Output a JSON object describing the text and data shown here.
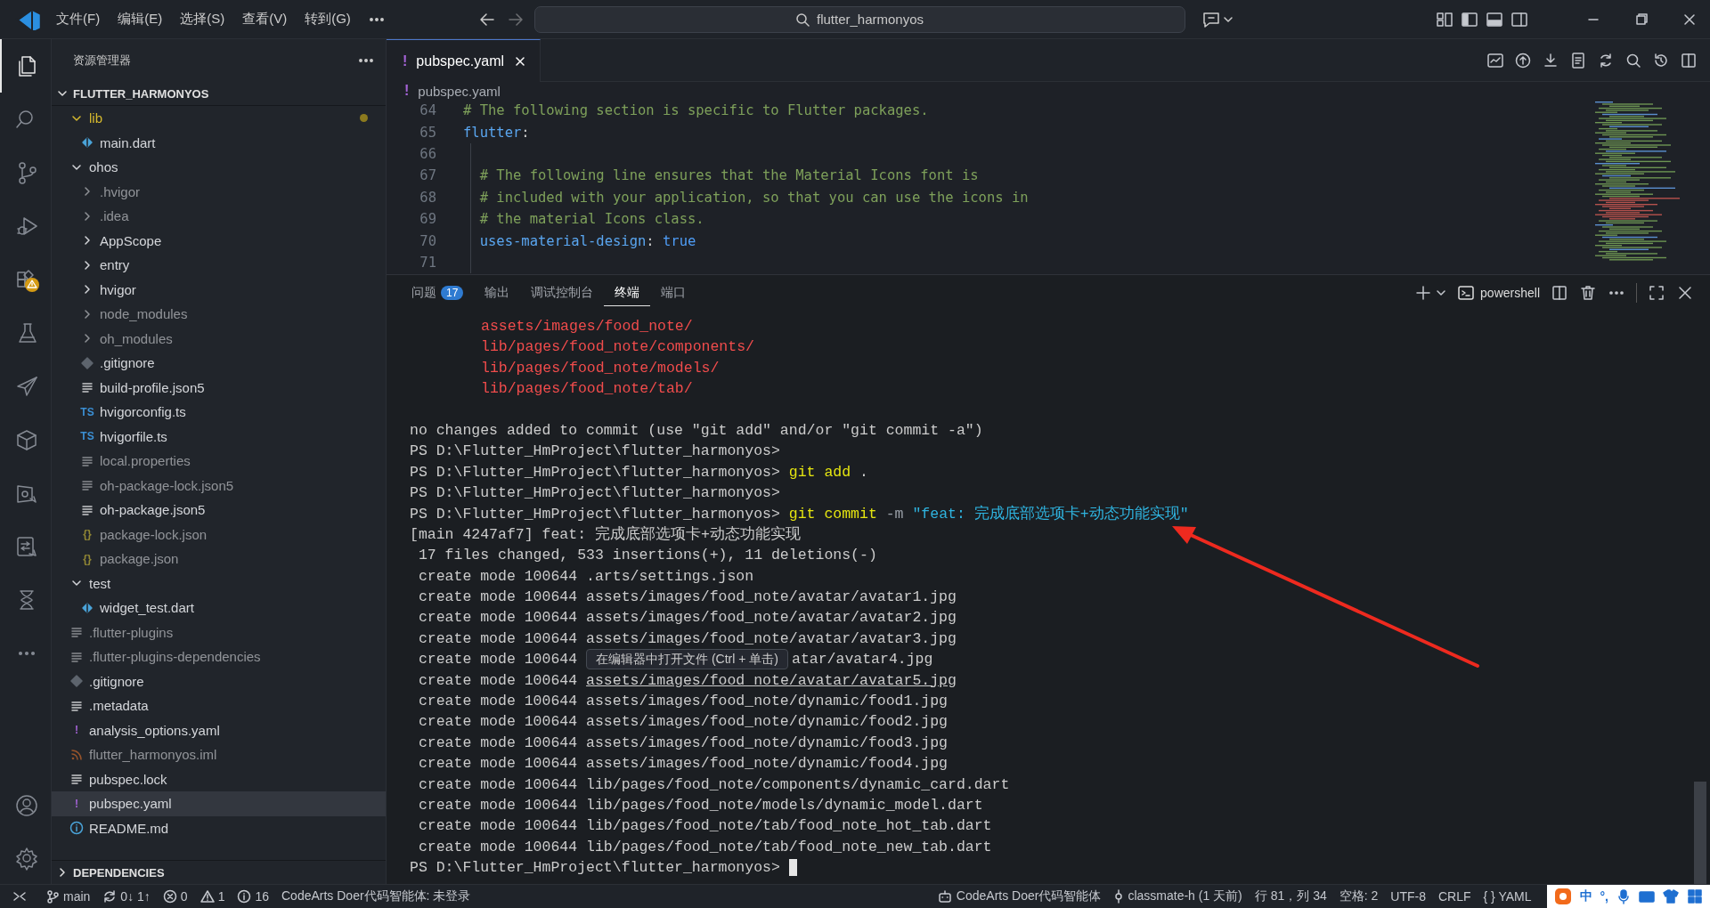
{
  "title_bar": {
    "menus": [
      "文件(F)",
      "编辑(E)",
      "选择(S)",
      "查看(V)",
      "转到(G)"
    ],
    "command_center": "flutter_harmonyos"
  },
  "activity_bar": {
    "top": [
      {
        "kind": "files",
        "selected": true
      },
      {
        "kind": "search",
        "selected": false
      },
      {
        "kind": "source-control",
        "selected": false
      },
      {
        "kind": "run-debug",
        "selected": false
      },
      {
        "kind": "extensions",
        "selected": false
      },
      {
        "kind": "flask",
        "selected": false
      },
      {
        "kind": "paper-plane",
        "selected": false
      },
      {
        "kind": "cube",
        "selected": false
      },
      {
        "kind": "device-bug",
        "selected": false
      },
      {
        "kind": "checklist",
        "selected": false
      },
      {
        "kind": "hourglass",
        "selected": false
      },
      {
        "kind": "more",
        "selected": false
      }
    ],
    "bottom": [
      {
        "kind": "account",
        "selected": false
      },
      {
        "kind": "settings",
        "selected": false
      }
    ]
  },
  "explorer": {
    "title": "资源管理器",
    "root": "FLUTTER_HARMONYOS",
    "tree": [
      {
        "name": "lib",
        "kind": "folder",
        "expanded": true,
        "modified": true,
        "dimmed": false,
        "selected": false,
        "children": [
          {
            "name": "main.dart",
            "kind": "dart",
            "modified": false,
            "dimmed": false,
            "selected": false
          }
        ]
      },
      {
        "name": "ohos",
        "kind": "folder",
        "expanded": true,
        "modified": false,
        "dimmed": false,
        "selected": false,
        "children": [
          {
            "name": ".hvigor",
            "kind": "folder",
            "expanded": false,
            "modified": false,
            "dimmed": true,
            "selected": false
          },
          {
            "name": ".idea",
            "kind": "folder",
            "expanded": false,
            "modified": false,
            "dimmed": true,
            "selected": false
          },
          {
            "name": "AppScope",
            "kind": "folder",
            "expanded": false,
            "modified": false,
            "dimmed": false,
            "selected": false
          },
          {
            "name": "entry",
            "kind": "folder",
            "expanded": false,
            "modified": false,
            "dimmed": false,
            "selected": false
          },
          {
            "name": "hvigor",
            "kind": "folder",
            "expanded": false,
            "modified": false,
            "dimmed": false,
            "selected": false
          },
          {
            "name": "node_modules",
            "kind": "folder",
            "expanded": false,
            "modified": false,
            "dimmed": true,
            "selected": false
          },
          {
            "name": "oh_modules",
            "kind": "folder",
            "expanded": false,
            "modified": false,
            "dimmed": true,
            "selected": false
          },
          {
            "name": ".gitignore",
            "kind": "git",
            "modified": false,
            "dimmed": false,
            "selected": false
          },
          {
            "name": "build-profile.json5",
            "kind": "lines",
            "modified": false,
            "dimmed": false,
            "selected": false
          },
          {
            "name": "hvigorconfig.ts",
            "kind": "ts",
            "icon_label": "TS",
            "modified": false,
            "dimmed": false,
            "selected": false
          },
          {
            "name": "hvigorfile.ts",
            "kind": "ts",
            "icon_label": "TS",
            "modified": false,
            "dimmed": false,
            "selected": false
          },
          {
            "name": "local.properties",
            "kind": "lines",
            "modified": false,
            "dimmed": true,
            "selected": false
          },
          {
            "name": "oh-package-lock.json5",
            "kind": "lines",
            "modified": false,
            "dimmed": true,
            "selected": false
          },
          {
            "name": "oh-package.json5",
            "kind": "lines",
            "modified": false,
            "dimmed": false,
            "selected": false
          },
          {
            "name": "package-lock.json",
            "kind": "json",
            "icon_label": "{}",
            "modified": false,
            "dimmed": true,
            "selected": false
          },
          {
            "name": "package.json",
            "kind": "json",
            "icon_label": "{}",
            "modified": false,
            "dimmed": true,
            "selected": false
          }
        ]
      },
      {
        "name": "test",
        "kind": "folder",
        "expanded": true,
        "modified": false,
        "dimmed": false,
        "selected": false,
        "children": [
          {
            "name": "widget_test.dart",
            "kind": "dart",
            "modified": false,
            "dimmed": false,
            "selected": false
          }
        ]
      },
      {
        "name": ".flutter-plugins",
        "kind": "lines",
        "modified": false,
        "dimmed": true,
        "selected": false
      },
      {
        "name": ".flutter-plugins-dependencies",
        "kind": "lines",
        "modified": false,
        "dimmed": true,
        "selected": false
      },
      {
        "name": ".gitignore",
        "kind": "git",
        "modified": false,
        "dimmed": false,
        "selected": false
      },
      {
        "name": ".metadata",
        "kind": "lines",
        "modified": false,
        "dimmed": false,
        "selected": false
      },
      {
        "name": "analysis_options.yaml",
        "kind": "yaml",
        "icon_label": "!",
        "modified": false,
        "dimmed": false,
        "selected": false
      },
      {
        "name": "flutter_harmonyos.iml",
        "kind": "rss",
        "modified": false,
        "dimmed": true,
        "selected": false
      },
      {
        "name": "pubspec.lock",
        "kind": "lines",
        "modified": false,
        "dimmed": false,
        "selected": false
      },
      {
        "name": "pubspec.yaml",
        "kind": "yaml",
        "icon_label": "!",
        "modified": false,
        "dimmed": false,
        "selected": true
      },
      {
        "name": "README.md",
        "kind": "info",
        "modified": false,
        "dimmed": false,
        "selected": false
      }
    ],
    "dependencies": "DEPENDENCIES"
  },
  "editor": {
    "tabs": [
      {
        "label": "pubspec.yaml",
        "icon_label": "!",
        "selected": true
      }
    ],
    "breadcrumb": {
      "icon_label": "!",
      "text": "pubspec.yaml"
    },
    "lines": [
      {
        "number": "64",
        "guide": false,
        "segments": [
          {
            "kind": "comment",
            "text": "# The following section is specific to Flutter packages."
          }
        ]
      },
      {
        "number": "65",
        "guide": false,
        "segments": [
          {
            "kind": "key",
            "text": "flutter"
          },
          {
            "kind": "plain",
            "text": ":"
          }
        ]
      },
      {
        "number": "66",
        "guide": true
      },
      {
        "number": "67",
        "guide": true,
        "segments": [
          {
            "kind": "comment",
            "text": "  # The following line ensures that the Material Icons font is"
          }
        ]
      },
      {
        "number": "68",
        "guide": true,
        "segments": [
          {
            "kind": "comment",
            "text": "  # included with your application, so that you can use the icons in"
          }
        ]
      },
      {
        "number": "69",
        "guide": true,
        "segments": [
          {
            "kind": "comment",
            "text": "  # the material Icons class."
          }
        ]
      },
      {
        "number": "70",
        "guide": true,
        "segments": [
          {
            "kind": "key",
            "text": "  uses-material-design"
          },
          {
            "kind": "plain",
            "text": ": "
          },
          {
            "kind": "bool",
            "text": "true"
          }
        ]
      },
      {
        "number": "71",
        "guide": true
      }
    ]
  },
  "panel": {
    "tabs": [
      {
        "label": "问题",
        "badge": "17",
        "selected": false
      },
      {
        "label": "输出",
        "selected": false
      },
      {
        "label": "调试控制台",
        "selected": false
      },
      {
        "label": "终端",
        "selected": true
      },
      {
        "label": "端口",
        "selected": false
      }
    ],
    "shell": "powershell",
    "terminal": [
      {
        "kind": "text",
        "segments": [
          {
            "kind": "untracked",
            "text": "assets/images/food_note/"
          }
        ]
      },
      {
        "kind": "text",
        "segments": [
          {
            "kind": "untracked",
            "text": "lib/pages/food_note/components/"
          }
        ]
      },
      {
        "kind": "text",
        "segments": [
          {
            "kind": "untracked",
            "text": "lib/pages/food_note/models/"
          }
        ]
      },
      {
        "kind": "text",
        "segments": [
          {
            "kind": "untracked",
            "text": "lib/pages/food_note/tab/"
          }
        ]
      },
      {
        "kind": "blank"
      },
      {
        "kind": "text",
        "segments": [
          {
            "kind": "output",
            "text": "no changes added to commit (use \"git add\" and/or \"git commit -a\")"
          }
        ]
      },
      {
        "kind": "text",
        "segments": [
          {
            "kind": "prompt",
            "text": "PS D:\\Flutter_HmProject\\flutter_harmonyos>"
          }
        ]
      },
      {
        "kind": "text",
        "segments": [
          {
            "kind": "prompt",
            "text": "PS D:\\Flutter_HmProject\\flutter_harmonyos> "
          },
          {
            "kind": "command",
            "text": "git add"
          },
          {
            "kind": "output",
            "text": " ."
          }
        ]
      },
      {
        "kind": "text",
        "segments": [
          {
            "kind": "prompt",
            "text": "PS D:\\Flutter_HmProject\\flutter_harmonyos>"
          }
        ]
      },
      {
        "kind": "text",
        "segments": [
          {
            "kind": "prompt",
            "text": "PS D:\\Flutter_HmProject\\flutter_harmonyos> "
          },
          {
            "kind": "command",
            "text": "git commit"
          },
          {
            "kind": "flag",
            "text": " -m "
          },
          {
            "kind": "string",
            "text": "\"feat: 完成底部选项卡+动态功能实现\""
          }
        ]
      },
      {
        "kind": "text",
        "segments": [
          {
            "kind": "output",
            "text": "[main 4247af7] feat: 完成底部选项卡+动态功能实现"
          }
        ]
      },
      {
        "kind": "text",
        "segments": [
          {
            "kind": "output",
            "text": " 17 files changed, 533 insertions(+), 11 deletions(-)"
          }
        ]
      },
      {
        "kind": "text",
        "segments": [
          {
            "kind": "output",
            "text": " create mode 100644 .arts/settings.json"
          }
        ]
      },
      {
        "kind": "text",
        "segments": [
          {
            "kind": "output",
            "text": " create mode 100644 assets/images/food_note/avatar/avatar1.jpg"
          }
        ]
      },
      {
        "kind": "text",
        "segments": [
          {
            "kind": "output",
            "text": " create mode 100644 assets/images/food_note/avatar/avatar2.jpg"
          }
        ]
      },
      {
        "kind": "text",
        "segments": [
          {
            "kind": "output",
            "text": " create mode 100644 assets/images/food_note/avatar/avatar3.jpg"
          }
        ]
      },
      {
        "kind": "text",
        "segments": [
          {
            "kind": "output",
            "text": " create mode 100644 "
          },
          {
            "kind": "tooltip",
            "text": "在编辑器中打开文件 (Ctrl + 单击)"
          },
          {
            "kind": "output",
            "text": "atar/avatar4.jpg"
          }
        ]
      },
      {
        "kind": "text",
        "segments": [
          {
            "kind": "output",
            "text": " create mode 100644 "
          },
          {
            "kind": "link",
            "text": "assets/images/food_note/avatar/avatar5.jpg"
          }
        ]
      },
      {
        "kind": "text",
        "segments": [
          {
            "kind": "output",
            "text": " create mode 100644 assets/images/food_note/dynamic/food1.jpg"
          }
        ]
      },
      {
        "kind": "text",
        "segments": [
          {
            "kind": "output",
            "text": " create mode 100644 assets/images/food_note/dynamic/food2.jpg"
          }
        ]
      },
      {
        "kind": "text",
        "segments": [
          {
            "kind": "output",
            "text": " create mode 100644 assets/images/food_note/dynamic/food3.jpg"
          }
        ]
      },
      {
        "kind": "text",
        "segments": [
          {
            "kind": "output",
            "text": " create mode 100644 assets/images/food_note/dynamic/food4.jpg"
          }
        ]
      },
      {
        "kind": "text",
        "segments": [
          {
            "kind": "output",
            "text": " create mode 100644 lib/pages/food_note/components/dynamic_card.dart"
          }
        ]
      },
      {
        "kind": "text",
        "segments": [
          {
            "kind": "output",
            "text": " create mode 100644 lib/pages/food_note/models/dynamic_model.dart"
          }
        ]
      },
      {
        "kind": "text",
        "segments": [
          {
            "kind": "output",
            "text": " create mode 100644 lib/pages/food_note/tab/food_note_hot_tab.dart"
          }
        ]
      },
      {
        "kind": "text",
        "segments": [
          {
            "kind": "output",
            "text": " create mode 100644 lib/pages/food_note/tab/food_note_new_tab.dart"
          }
        ]
      },
      {
        "kind": "text",
        "segments": [
          {
            "kind": "prompt",
            "text": "PS D:\\Flutter_HmProject\\flutter_harmonyos>"
          }
        ]
      }
    ]
  },
  "status_bar": {
    "left": [
      {
        "kind": "remote"
      },
      {
        "kind": "branch",
        "text": "main"
      },
      {
        "kind": "sync",
        "text": "0↓ 1↑"
      },
      {
        "kind": "errors",
        "text": "0"
      },
      {
        "kind": "warnings",
        "text": "1"
      },
      {
        "kind": "info",
        "text": "16"
      },
      {
        "kind": "plain",
        "text": "CodeArts Doer代码智能体: 未登录"
      }
    ],
    "right": [
      {
        "kind": "agent",
        "text": "CodeArts Doer代码智能体"
      },
      {
        "kind": "commit",
        "text": "classmate-h (1 天前)"
      },
      {
        "kind": "plain",
        "text": "行 81，列 34"
      },
      {
        "kind": "plain",
        "text": "空格: 2"
      },
      {
        "kind": "plain",
        "text": "UTF-8"
      },
      {
        "kind": "plain",
        "text": "CRLF"
      },
      {
        "kind": "plain",
        "text": "{ } YAML"
      }
    ],
    "ime": {
      "mode": "中",
      "punctuation": "°,"
    }
  }
}
